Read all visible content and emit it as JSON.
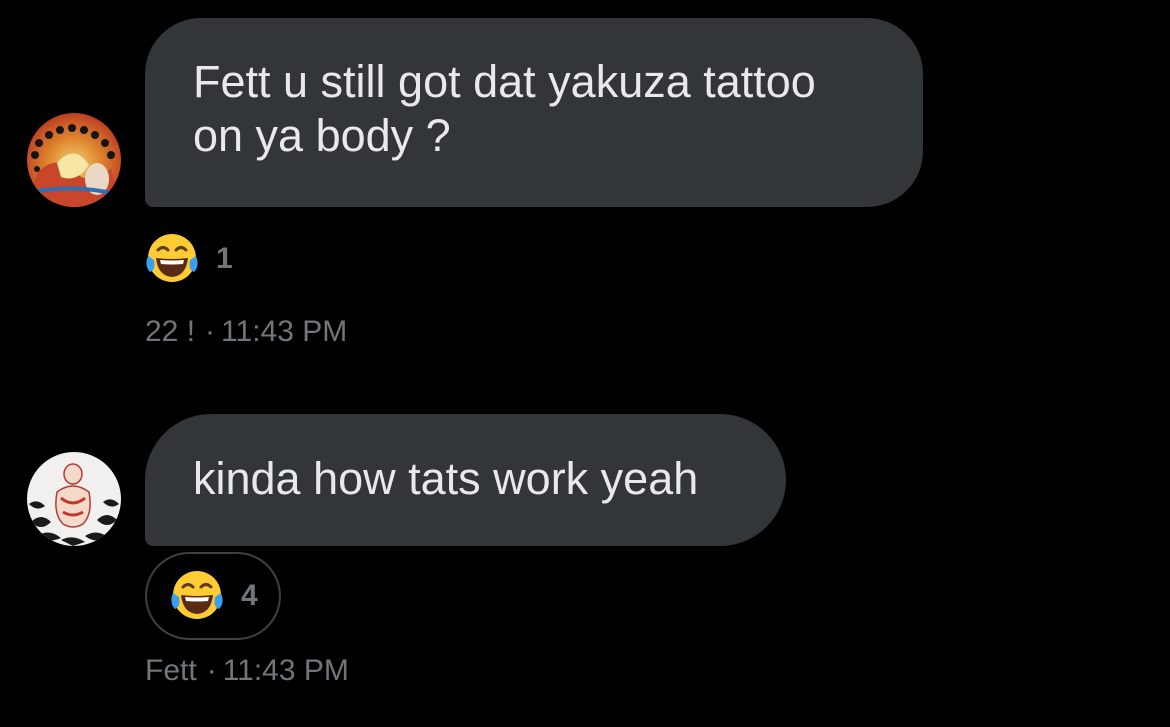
{
  "messages": [
    {
      "text": "Fett u still got dat yakuza tattoo on ya body ?",
      "avatar_icon": "psychedelic-art-avatar",
      "reaction": {
        "emoji": "face-with-tears-of-joy",
        "count": "1"
      },
      "sender": "22 !",
      "separator": "·",
      "time": "11:43 PM"
    },
    {
      "text": "kinda how tats work yeah",
      "avatar_icon": "illustrated-figure-avatar",
      "reaction": {
        "emoji": "face-with-tears-of-joy",
        "count": "4"
      },
      "sender": "Fett",
      "separator": "·",
      "time": "11:43 PM"
    }
  ],
  "colors": {
    "background": "#000000",
    "bubble": "#333639",
    "text": "#e7e9ea",
    "meta": "#71767b"
  }
}
